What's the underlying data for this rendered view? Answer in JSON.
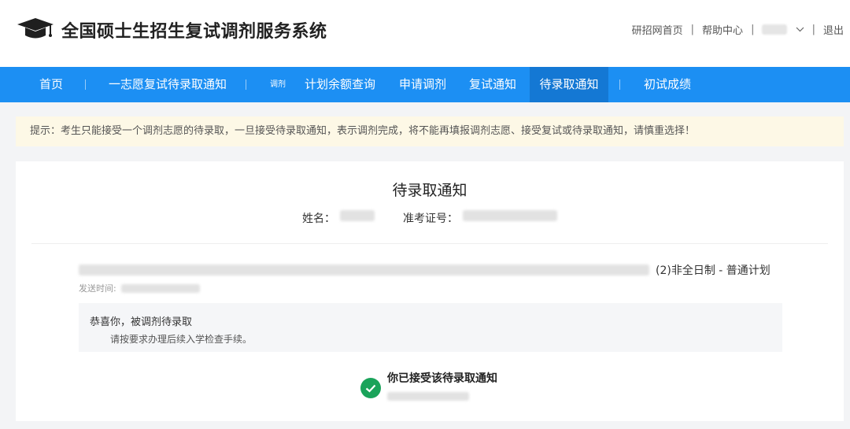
{
  "header": {
    "title": "全国硕士生招生复试调剂服务系统",
    "links": {
      "home": "研招网首页",
      "help": "帮助中心",
      "logout": "退出"
    },
    "separator": "|"
  },
  "nav": {
    "items": [
      {
        "label": "首页"
      },
      {
        "label": "一志愿复试待录取通知"
      },
      {
        "label": "调剂"
      },
      {
        "label": "计划余额查询"
      },
      {
        "label": "申请调剂"
      },
      {
        "label": "复试通知"
      },
      {
        "label": "待录取通知"
      },
      {
        "label": "初试成绩"
      }
    ],
    "active": "待录取通知",
    "color": "#1c8ff3"
  },
  "tip": "提示：考生只能接受一个调剂志愿的待录取，一旦接受待录取通知，表示调剂完成，将不能再填报调剂志愿、接受复试或待录取通知，请慎重选择！",
  "card": {
    "title": "待录取通知",
    "name_label": "姓名：",
    "exam_no_label": "准考证号：",
    "study_mode": "(2)非全日制 - 普通计划",
    "send_time_label": "发送时间:",
    "message_title": "恭喜你，被调剂待录取",
    "message_body": "请按要求办理后续入学检查手续。",
    "accepted_text": "你已接受该待录取通知",
    "accent_green": "#1aa35a"
  }
}
